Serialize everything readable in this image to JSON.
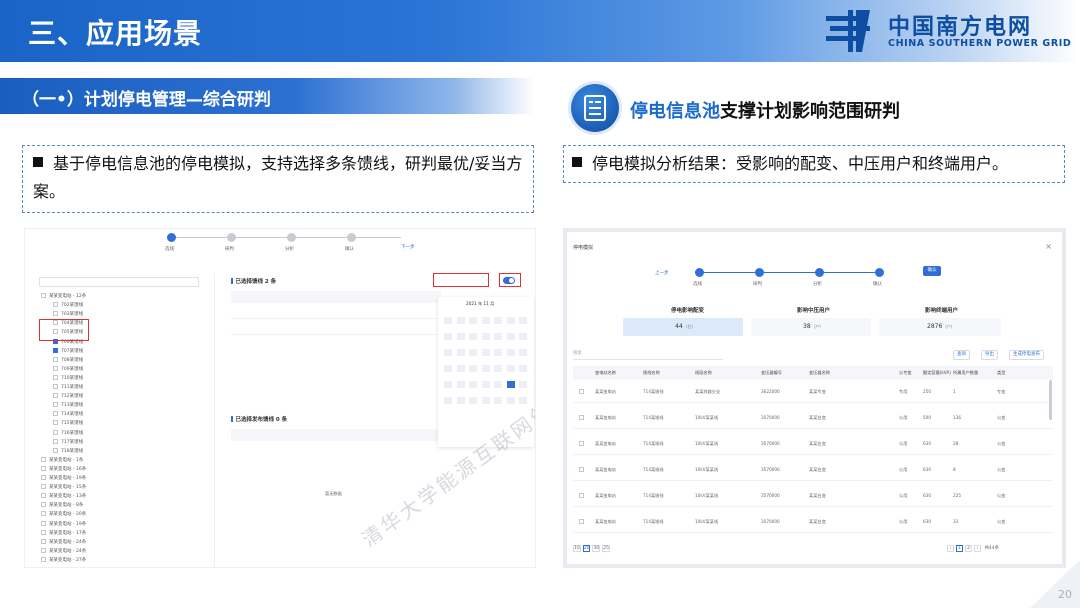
{
  "header": {
    "title": "三、应用场景",
    "logo_cn": "中国南方电网",
    "logo_en": "CHINA SOUTHERN POWER GRID"
  },
  "left": {
    "banner": "（一•）计划停电管理—综合研判",
    "note": "基于停电信息池的停电模拟，支持选择多条馈线，研判最优/妥当方案。",
    "screenshot": {
      "steps": [
        "选线",
        "研判",
        "分析",
        "确认"
      ],
      "next_label": "下一步",
      "selected_title": "已选择馈线 2 条",
      "pending_title": "已选择发布馈线 0 条",
      "calendar_label": "2021 年 11 月",
      "empty_label": "暂无数据",
      "tree_rows": [
        "某某变电站 - 12条",
        "702某馈线",
        "703某馈线",
        "704某馈线",
        "705某馈线",
        "706某馈线",
        "707某馈线",
        "708某馈线",
        "709某馈线",
        "710某馈线",
        "711某馈线",
        "712某馈线",
        "713某馈线",
        "714某馈线",
        "715某馈线",
        "716某馈线",
        "717某馈线",
        "718某馈线",
        "某某变电站 - 1条",
        "某某变电站 - 16条",
        "某某变电站 - 19条",
        "某某变电站 - 15条",
        "某某变电站 - 13条",
        "某某变电站 - 8条",
        "某某变电站 - 20条",
        "某某变电站 - 19条",
        "某某变电站 - 17条",
        "某某变电站 - 24条",
        "某某变电站 - 24条",
        "某某变电站 - 27条"
      ]
    }
  },
  "right": {
    "title_highlight": "停电信息池",
    "title_rest": "支撑计划影响范围研判",
    "note": "停电模拟分析结果：受影响的配变、中压用户和终端用户。",
    "screenshot": {
      "dialog_title": "停电模拟",
      "prev_label": "上一步",
      "steps": [
        "选线",
        "研判",
        "分析",
        "确认"
      ],
      "confirm_label": "确认",
      "stats": [
        {
          "label": "停电影响配变",
          "value": "44",
          "unit": "(台)"
        },
        {
          "label": "影响中压用户",
          "value": "38",
          "unit": "(户)"
        },
        {
          "label": "影响终端用户",
          "value": "2876",
          "unit": "(户)"
        }
      ],
      "filter_placeholder": "搜索",
      "buttons": [
        "查询",
        "导出",
        "生成停电发布"
      ],
      "columns": [
        "变电站名称",
        "馈线名称",
        "线段名称",
        "变压器编号",
        "变压器名称",
        "公专变",
        "额定容量(kVA)",
        "所属用户数量",
        "类型"
      ],
      "rows": [
        [
          "某某变电站",
          "714某馈线",
          "某某线路分支",
          "3622000",
          "某某专变",
          "专用",
          "250",
          "1",
          "专变"
        ],
        [
          "某某变电站",
          "714某馈线",
          "10kV某某线",
          "3570000",
          "某某台变",
          "公用",
          "500",
          "136",
          "公变"
        ],
        [
          "某某变电站",
          "714某馈线",
          "10kV某某线",
          "3570000",
          "某某台变",
          "公用",
          "630",
          "28",
          "公变"
        ],
        [
          "某某变电站",
          "714某馈线",
          "10kV某某线",
          "3570000",
          "某某台变",
          "公用",
          "630",
          "8",
          "公变"
        ],
        [
          "某某变电站",
          "714某馈线",
          "10kV某某线",
          "3570000",
          "某某台变",
          "公用",
          "630",
          "225",
          "公变"
        ],
        [
          "某某变电站",
          "714某馈线",
          "10kV某某线",
          "3570000",
          "某某台变",
          "公用",
          "630",
          "33",
          "公变"
        ]
      ],
      "pager_sizes": [
        "10",
        "20",
        "30",
        "25"
      ],
      "pager_pages": [
        "1",
        "2"
      ],
      "pager_total": "共44条"
    }
  },
  "watermark": "清华大学能源互联网创新研究院",
  "page_number": "20"
}
